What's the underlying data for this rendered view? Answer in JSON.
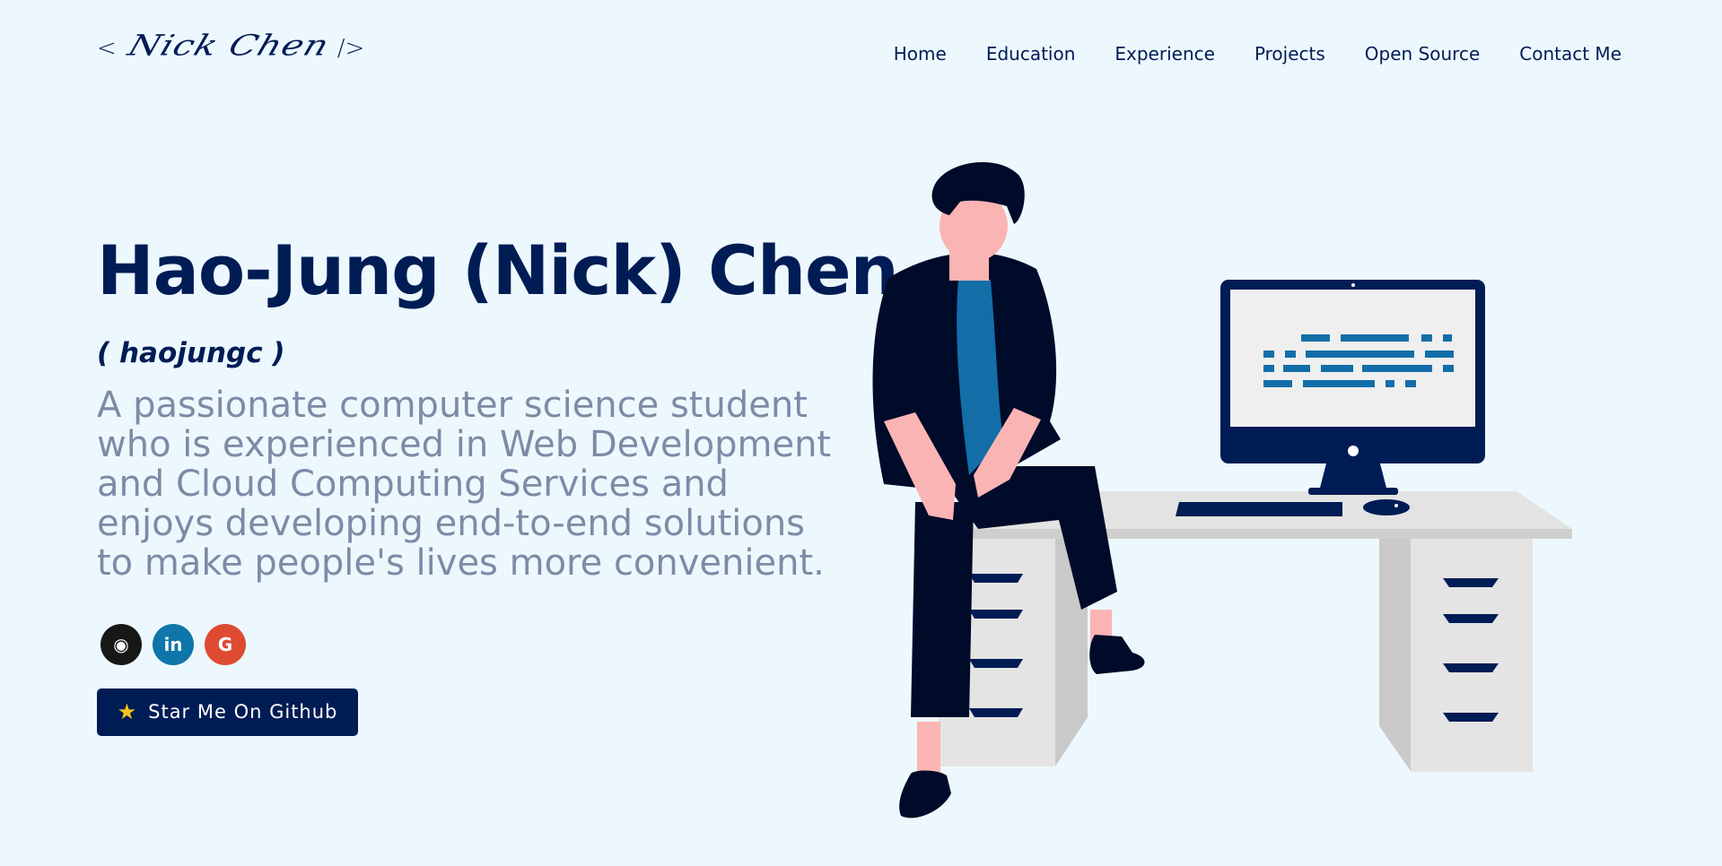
{
  "logo": {
    "open": "<",
    "signature": "Nick Chen",
    "close": "/>"
  },
  "nav": {
    "items": [
      "Home",
      "Education",
      "Experience",
      "Projects",
      "Open Source",
      "Contact Me"
    ]
  },
  "hero": {
    "name": "Hao-Jung (Nick) Chen",
    "username": "( haojungc )",
    "description": "A passionate computer science student who is experienced in Web Development and Cloud Computing Services and enjoys developing end-to-end solutions to make people's lives more convenient.",
    "socials": [
      {
        "icon": "github-icon",
        "glyph": "◉",
        "color": "#181717"
      },
      {
        "icon": "linkedin-icon",
        "glyph": "in",
        "color": "#0e76a8"
      },
      {
        "icon": "google-icon",
        "glyph": "G",
        "color": "#df4a32"
      }
    ],
    "star_button": {
      "icon": "star-icon",
      "glyph": "★",
      "label": "Star Me On Github"
    }
  },
  "colors": {
    "background": "#edf8fe",
    "primary": "#001c55",
    "muted_text": "#7f8aa6",
    "accent_blue": "#136ea8"
  }
}
